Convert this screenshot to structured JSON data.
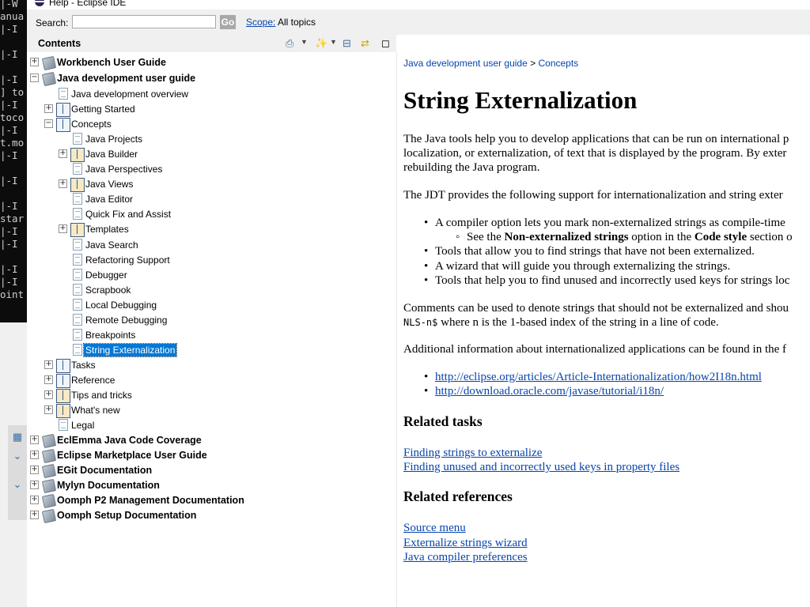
{
  "window": {
    "title": "Help - Eclipse IDE"
  },
  "terminal": {
    "lines": [
      "|-W",
      "anua",
      "|-I",
      "",
      "|-I",
      "",
      "|-I",
      "] to",
      "|-I",
      "toco",
      "|-I",
      "t.mo",
      "|-I",
      "",
      "|-I",
      "",
      "|-I",
      "star",
      "|-I",
      "|-I",
      "",
      "|-I",
      "|-I",
      "oint"
    ]
  },
  "search": {
    "label": "Search:",
    "value": "",
    "go_label": "Go",
    "scope_label": "Scope:",
    "scope_value": "All topics"
  },
  "contents": {
    "title": "Contents",
    "toolbar_icons": [
      "print-icon",
      "highlight-search-icon",
      "collapse-all-icon",
      "link-with-contents-icon",
      "maximize-icon"
    ]
  },
  "tree": [
    {
      "label": "Workbench User Guide",
      "bold": true,
      "level": 0,
      "icon": "book-grey",
      "expander": "+"
    },
    {
      "label": "Java development user guide",
      "bold": true,
      "level": 0,
      "icon": "book-grey",
      "expander": "-"
    },
    {
      "label": "Java development overview",
      "level": 1,
      "icon": "page"
    },
    {
      "label": "Getting Started",
      "level": 1,
      "icon": "book-open",
      "expander": "+"
    },
    {
      "label": "Concepts",
      "level": 1,
      "icon": "book-open",
      "expander": "-"
    },
    {
      "label": "Java Projects",
      "level": 2,
      "icon": "page"
    },
    {
      "label": "Java Builder",
      "level": 2,
      "icon": "book-multi",
      "expander": "+"
    },
    {
      "label": "Java Perspectives",
      "level": 2,
      "icon": "page"
    },
    {
      "label": "Java Views",
      "level": 2,
      "icon": "book-multi",
      "expander": "+"
    },
    {
      "label": "Java Editor",
      "level": 2,
      "icon": "page"
    },
    {
      "label": "Quick Fix and Assist",
      "level": 2,
      "icon": "page"
    },
    {
      "label": "Templates",
      "level": 2,
      "icon": "book-multi",
      "expander": "+"
    },
    {
      "label": "Java Search",
      "level": 2,
      "icon": "page"
    },
    {
      "label": "Refactoring Support",
      "level": 2,
      "icon": "page"
    },
    {
      "label": "Debugger",
      "level": 2,
      "icon": "page"
    },
    {
      "label": "Scrapbook",
      "level": 2,
      "icon": "page"
    },
    {
      "label": "Local Debugging",
      "level": 2,
      "icon": "page"
    },
    {
      "label": "Remote Debugging",
      "level": 2,
      "icon": "page"
    },
    {
      "label": "Breakpoints",
      "level": 2,
      "icon": "page"
    },
    {
      "label": "String Externalization",
      "level": 2,
      "icon": "page",
      "selected": true
    },
    {
      "label": "Tasks",
      "level": 1,
      "icon": "book-open",
      "expander": "+"
    },
    {
      "label": "Reference",
      "level": 1,
      "icon": "book-open",
      "expander": "+"
    },
    {
      "label": "Tips and tricks",
      "level": 1,
      "icon": "book-multi",
      "expander": "+"
    },
    {
      "label": "What's new",
      "level": 1,
      "icon": "book-multi",
      "expander": "+"
    },
    {
      "label": "Legal",
      "level": 1,
      "icon": "page"
    },
    {
      "label": "EclEmma Java Code Coverage",
      "bold": true,
      "level": 0,
      "icon": "book-grey",
      "expander": "+"
    },
    {
      "label": "Eclipse Marketplace User Guide",
      "bold": true,
      "level": 0,
      "icon": "book-grey",
      "expander": "+"
    },
    {
      "label": "EGit Documentation",
      "bold": true,
      "level": 0,
      "icon": "book-grey",
      "expander": "+"
    },
    {
      "label": "Mylyn Documentation",
      "bold": true,
      "level": 0,
      "icon": "book-grey",
      "expander": "+"
    },
    {
      "label": "Oomph P2 Management Documentation",
      "bold": true,
      "level": 0,
      "icon": "book-grey",
      "expander": "+"
    },
    {
      "label": "Oomph Setup Documentation",
      "bold": true,
      "level": 0,
      "icon": "book-grey",
      "expander": "+"
    }
  ],
  "doc": {
    "breadcrumb": [
      "Java development user guide",
      "Concepts"
    ],
    "breadcrumb_sep": ">",
    "title": "String Externalization",
    "intro_lines": [
      "The Java tools help you to develop applications that can be run on international p",
      "localization, or externalization, of text that is displayed by the program. By exter",
      "rebuilding the Java program."
    ],
    "support_intro": "The JDT provides the following support for internationalization and string exter",
    "bullets": {
      "b1": "A compiler option lets you mark non-externalized strings as compile-time",
      "sub_prefix": "See the ",
      "sub_bold1": "Non-externalized strings",
      "sub_mid": " option in the ",
      "sub_bold2": "Code style",
      "sub_suffix": " section o",
      "b2": "Tools that allow you to find strings that have not been externalized.",
      "b3": "A wizard that will guide you through externalizing the strings.",
      "b4": "Tools that help you to find unused and incorrectly used keys for strings loc"
    },
    "comments_line1": "Comments can be used to denote strings that should not be externalized and shou",
    "comments_code": "NLS-n$",
    "comments_line2_rest": " where n is the 1-based index of the string in a line of code.",
    "additional": "Additional information about internationalized applications can be found in the f",
    "ext_links": [
      "http://eclipse.org/articles/Article-Internationalization/how2I18n.html",
      "http://download.oracle.com/javase/tutorial/i18n/"
    ],
    "related_tasks_heading": "Related tasks",
    "related_tasks": [
      "Finding strings to externalize",
      "Finding unused and incorrectly used keys in property files"
    ],
    "related_refs_heading": "Related references",
    "related_refs": [
      "Source menu",
      "Externalize strings wizard",
      "Java compiler preferences"
    ]
  }
}
